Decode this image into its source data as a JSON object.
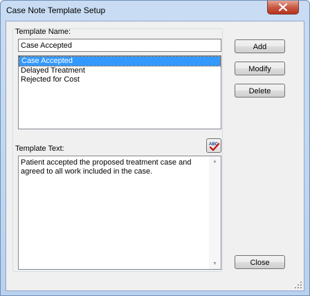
{
  "window": {
    "title": "Case Note Template Setup"
  },
  "template_name": {
    "label": "Template Name:",
    "value": "Case Accepted"
  },
  "templates": {
    "items": [
      {
        "label": "Case Accepted",
        "selected": true
      },
      {
        "label": "Delayed Treatment",
        "selected": false
      },
      {
        "label": "Rejected for Cost",
        "selected": false
      }
    ]
  },
  "template_text": {
    "label": "Template Text:",
    "value": "Patient accepted the proposed treatment case and agreed to all work included in the case.",
    "spellcheck_icon": "spellcheck-icon"
  },
  "buttons": {
    "add": "Add",
    "modify": "Modify",
    "delete": "Delete",
    "close": "Close"
  },
  "colors": {
    "selection": "#3399ff",
    "dialog_bg": "#f0f0f0",
    "title_bar": "#b9d1ee",
    "close_button": "#c75a45"
  }
}
